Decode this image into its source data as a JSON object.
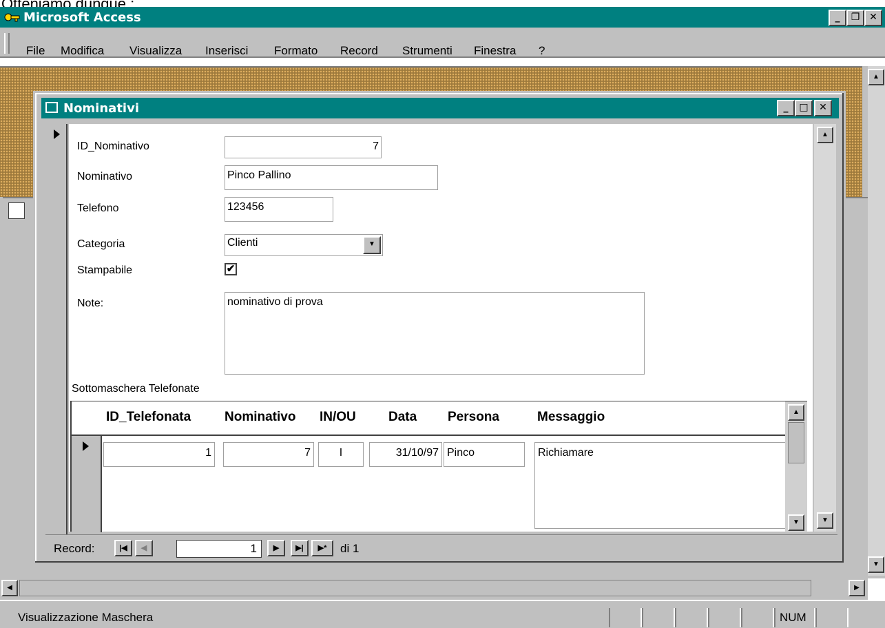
{
  "caption": "Otteniamo dunque :",
  "app": {
    "title": "Microsoft Access",
    "min_glyph": "_",
    "restore_glyph": "❐",
    "close_glyph": "✕"
  },
  "menu": [
    "File",
    "Modifica",
    "Visualizza",
    "Inserisci",
    "Formato",
    "Record",
    "Strumenti",
    "Finestra",
    "?"
  ],
  "form": {
    "title": "Nominativi",
    "fields": {
      "id_label": "ID_Nominativo",
      "id_value": "7",
      "nominativo_label": "Nominativo",
      "nominativo_value": "Pinco Pallino",
      "telefono_label": "Telefono",
      "telefono_value": "123456",
      "categoria_label": "Categoria",
      "categoria_value": "Clienti",
      "stampabile_label": "Stampabile",
      "stampabile_checked": true,
      "note_label": "Note:",
      "note_value": "nominativo di prova"
    },
    "subform": {
      "label": "Sottomaschera Telefonate",
      "columns": [
        "ID_Telefonata",
        "Nominativo",
        "IN/OU",
        "Data",
        "Persona",
        "Messaggio"
      ],
      "row": [
        "1",
        "7",
        "I",
        "31/10/97",
        "Pinco",
        "Richiamare"
      ]
    },
    "nav": {
      "label": "Record:",
      "current": "1",
      "total": "di 1"
    }
  },
  "status": {
    "text": "Visualizzazione Maschera",
    "num": "NUM"
  },
  "colors": {
    "titlebar": "#008080",
    "chrome": "#c0c0c0"
  }
}
